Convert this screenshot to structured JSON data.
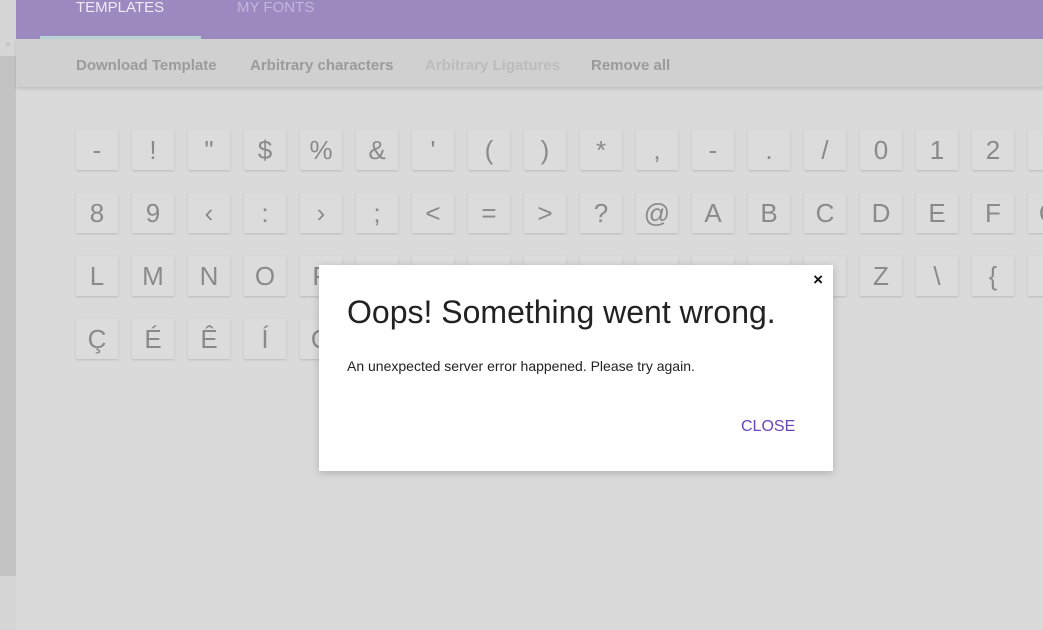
{
  "header": {
    "tabs": [
      {
        "label": "TEMPLATES",
        "active": true
      },
      {
        "label": "MY FONTS",
        "active": false
      }
    ]
  },
  "toolbar": {
    "items": [
      {
        "label": "Download Template",
        "disabled": false
      },
      {
        "label": "Arbitrary characters",
        "disabled": false
      },
      {
        "label": "Arbitrary Ligatures",
        "disabled": true
      },
      {
        "label": "Remove all",
        "disabled": false
      }
    ]
  },
  "grid": {
    "rows": [
      [
        "-",
        "!",
        "\"",
        "$",
        "%",
        "&",
        "'",
        "(",
        ")",
        "*",
        ",",
        "-",
        ".",
        "/",
        "0",
        "1",
        "2",
        ""
      ],
      [
        "8",
        "9",
        "‹",
        ":",
        "›",
        ";",
        "<",
        "=",
        ">",
        "?",
        "@",
        "A",
        "B",
        "C",
        "D",
        "E",
        "F",
        "G"
      ],
      [
        "L",
        "M",
        "N",
        "O",
        "P",
        "",
        "",
        "",
        "",
        "",
        "",
        "",
        "",
        "",
        "Z",
        "\\",
        "{",
        ""
      ],
      [
        "Ç",
        "É",
        "Ê",
        "Í",
        "Ó"
      ]
    ]
  },
  "modal": {
    "title": "Oops! Something went wrong.",
    "message": "An unexpected server error happened. Please try again.",
    "close_label": "CLOSE",
    "close_icon": "×"
  },
  "colors": {
    "header": "#9b89c0",
    "accent": "#6a45b8"
  }
}
